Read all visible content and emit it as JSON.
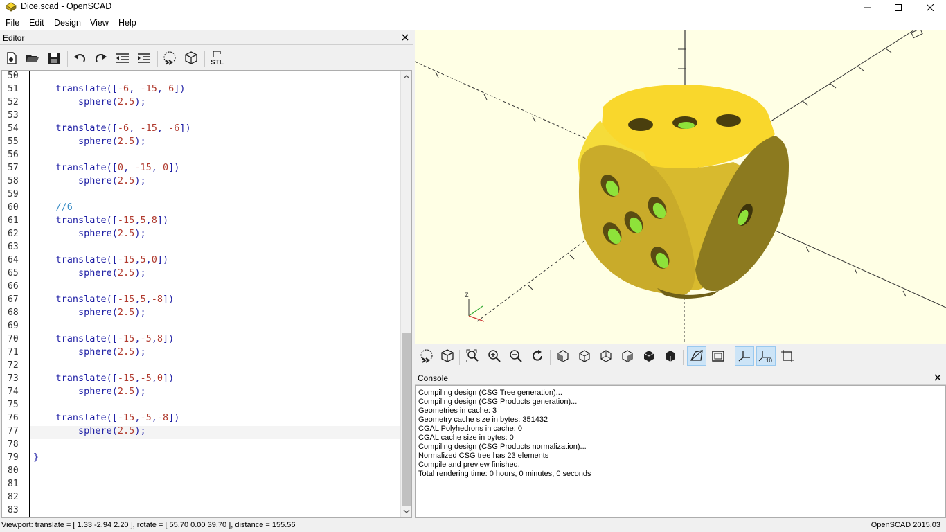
{
  "window": {
    "title": "Dice.scad - OpenSCAD"
  },
  "menu": [
    "File",
    "Edit",
    "Design",
    "View",
    "Help"
  ],
  "editor": {
    "title": "Editor",
    "toolbar": [
      "new-file",
      "open-file",
      "save-file",
      "undo",
      "redo",
      "unindent",
      "indent",
      "preview",
      "render",
      "export-stl"
    ],
    "stl_label": "STL",
    "lines": [
      {
        "n": "50",
        "text": ""
      },
      {
        "n": "51",
        "text": "    translate([-6, -15, 6])"
      },
      {
        "n": "52",
        "text": "        sphere(2.5);"
      },
      {
        "n": "53",
        "text": ""
      },
      {
        "n": "54",
        "text": "    translate([-6, -15, -6])"
      },
      {
        "n": "55",
        "text": "        sphere(2.5);"
      },
      {
        "n": "56",
        "text": ""
      },
      {
        "n": "57",
        "text": "    translate([0, -15, 0])"
      },
      {
        "n": "58",
        "text": "        sphere(2.5);"
      },
      {
        "n": "59",
        "text": ""
      },
      {
        "n": "60",
        "text": "    //6"
      },
      {
        "n": "61",
        "text": "    translate([-15,5,8])"
      },
      {
        "n": "62",
        "text": "        sphere(2.5);"
      },
      {
        "n": "63",
        "text": ""
      },
      {
        "n": "64",
        "text": "    translate([-15,5,0])"
      },
      {
        "n": "65",
        "text": "        sphere(2.5);"
      },
      {
        "n": "66",
        "text": ""
      },
      {
        "n": "67",
        "text": "    translate([-15,5,-8])"
      },
      {
        "n": "68",
        "text": "        sphere(2.5);"
      },
      {
        "n": "69",
        "text": ""
      },
      {
        "n": "70",
        "text": "    translate([-15,-5,8])"
      },
      {
        "n": "71",
        "text": "        sphere(2.5);"
      },
      {
        "n": "72",
        "text": ""
      },
      {
        "n": "73",
        "text": "    translate([-15,-5,0])"
      },
      {
        "n": "74",
        "text": "        sphere(2.5);"
      },
      {
        "n": "75",
        "text": ""
      },
      {
        "n": "76",
        "text": "    translate([-15,-5,-8])"
      },
      {
        "n": "77",
        "text": "        sphere(2.5);"
      },
      {
        "n": "78",
        "text": ""
      },
      {
        "n": "79",
        "text": "}"
      },
      {
        "n": "80",
        "text": ""
      },
      {
        "n": "81",
        "text": ""
      },
      {
        "n": "82",
        "text": ""
      },
      {
        "n": "83",
        "text": ""
      }
    ],
    "current_line": "77"
  },
  "viewport": {
    "axis_label": "Z",
    "scale_label": "10"
  },
  "view_toolbar": [
    "preview",
    "render",
    "view-all",
    "zoom-in",
    "zoom-out",
    "reset-view",
    "view-right",
    "view-top",
    "view-bottom",
    "view-left",
    "view-front",
    "view-back",
    "perspective",
    "orthogonal",
    "show-axes",
    "show-scale-markers",
    "show-edges"
  ],
  "console": {
    "title": "Console",
    "lines": [
      "Compiling design (CSG Tree generation)...",
      "Compiling design (CSG Products generation)...",
      "Geometries in cache: 3",
      "Geometry cache size in bytes: 351432",
      "CGAL Polyhedrons in cache: 0",
      "CGAL cache size in bytes: 0",
      "Compiling design (CSG Products normalization)...",
      "Normalized CSG tree has 23 elements",
      "Compile and preview finished.",
      "Total rendering time: 0 hours, 0 minutes, 0 seconds"
    ]
  },
  "status": {
    "viewport_info": "Viewport: translate = [ 1.33 -2.94 2.20 ], rotate = [ 55.70 0.00 39.70 ], distance = 155.56",
    "version": "OpenSCAD 2015.03"
  },
  "colors": {
    "viewport_bg": "#ffffe5",
    "dice_yellow": "#f9d72c",
    "dice_side": "#c9ab2a",
    "dice_dark": "#8c7a1f",
    "pip_green": "#8ee23a"
  }
}
